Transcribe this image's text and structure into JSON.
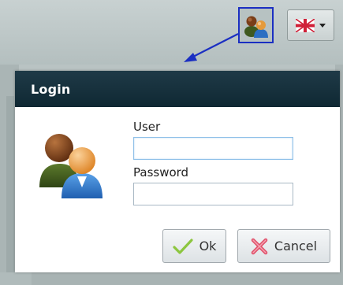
{
  "topbar": {
    "user_button_icon": "users-icon",
    "language_flag_icon": "uk-flag-icon",
    "language_caret_icon": "chevron-down-icon"
  },
  "dialog": {
    "title": "Login",
    "avatar_icon": "users-icon",
    "user_label": "User",
    "user_value": "",
    "password_label": "Password",
    "password_value": "",
    "ok_label": "Ok",
    "ok_icon": "check-icon",
    "cancel_label": "Cancel",
    "cancel_icon": "close-icon"
  },
  "colors": {
    "highlight_border": "#1b2fc2",
    "titlebar": "#132f3b",
    "ok_check": "#8cc63f",
    "cancel_x": "#e0506a"
  }
}
